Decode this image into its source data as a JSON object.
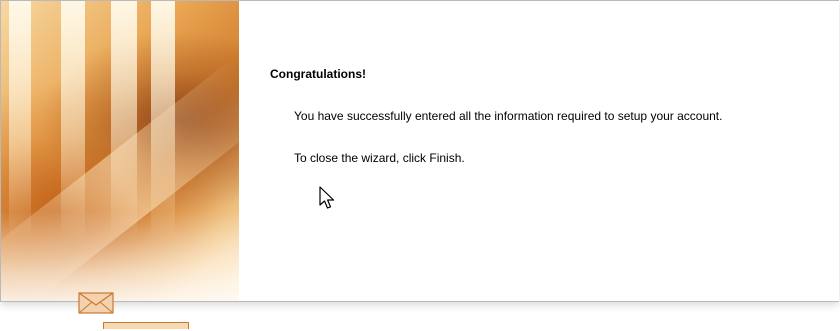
{
  "wizard": {
    "heading": "Congratulations!",
    "message": "You have successfully entered all the information required to setup your account.",
    "close_instruction": "To close the wizard, click Finish."
  },
  "side_panel": {
    "icon": "envelope-icon"
  },
  "cursor": {
    "icon": "mouse-pointer-icon"
  },
  "colors": {
    "art_light": "#f7d9a2",
    "art_mid": "#e9a552",
    "art_dark": "#cf7a2a",
    "art_shadow": "#7a2d0a",
    "text": "#000000",
    "background": "#ffffff"
  }
}
